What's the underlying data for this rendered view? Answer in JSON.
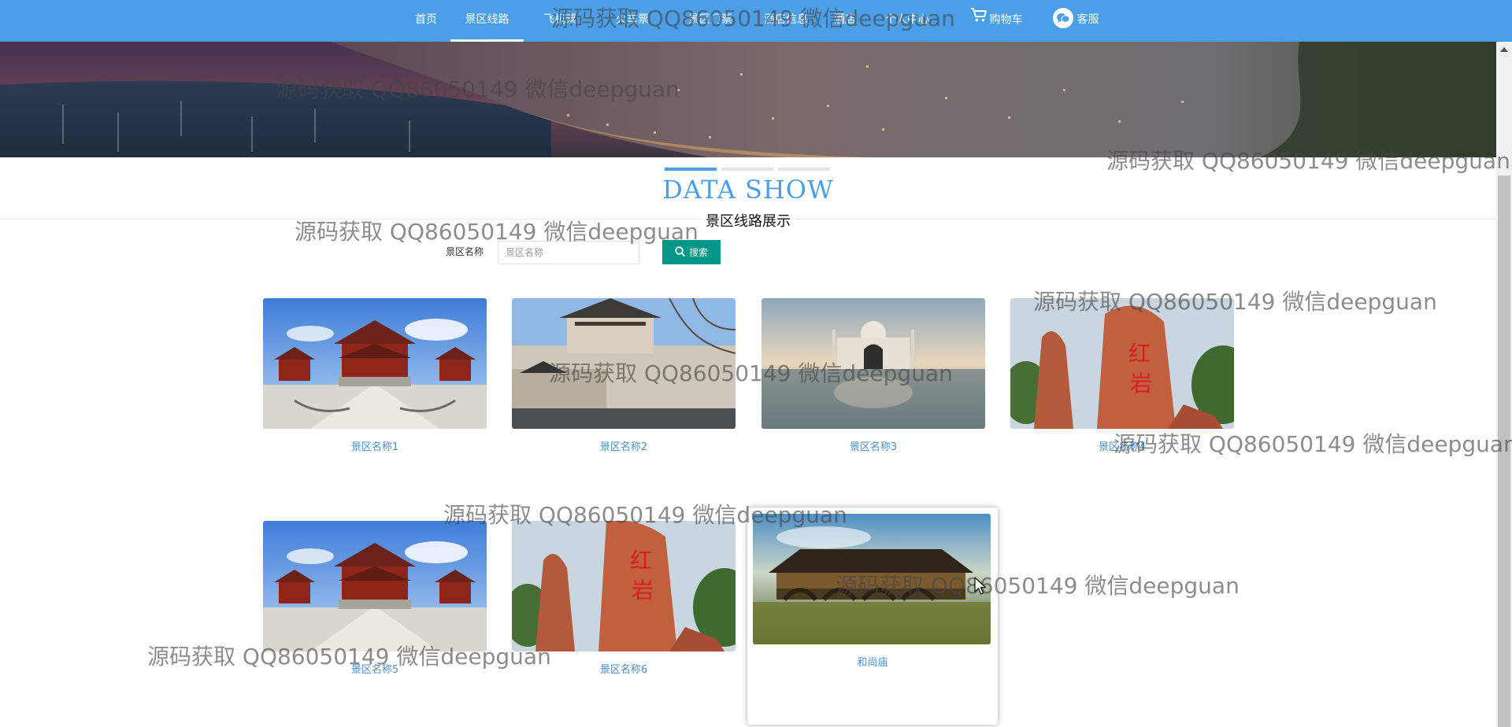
{
  "nav": {
    "items": [
      {
        "label": "首页"
      },
      {
        "label": "景区线路"
      },
      {
        "label": "飞机票"
      },
      {
        "label": "火车票"
      },
      {
        "label": "景区门票"
      },
      {
        "label": "酒店信息"
      },
      {
        "label": "酒店"
      },
      {
        "label": "个人中心"
      }
    ],
    "cart_label": "购物车",
    "service_label": "客服"
  },
  "section": {
    "title": "DATA SHOW",
    "subtitle": "景区线路展示"
  },
  "search": {
    "label": "景区名称",
    "placeholder": "景区名称",
    "button_label": "搜索"
  },
  "cards": [
    {
      "caption": "景区名称1"
    },
    {
      "caption": "景区名称2"
    },
    {
      "caption": "景区名称3"
    },
    {
      "caption": "景区名称4"
    },
    {
      "caption": "景区名称5"
    },
    {
      "caption": "景区名称6"
    },
    {
      "caption": "和尚庙"
    }
  ],
  "watermark": "源码获取 QQ86050149 微信deepguan",
  "colors": {
    "nav_bg": "#4a9fe8",
    "accent": "#4a9fe8",
    "search_button": "#009688",
    "caption": "#4a90c8"
  }
}
